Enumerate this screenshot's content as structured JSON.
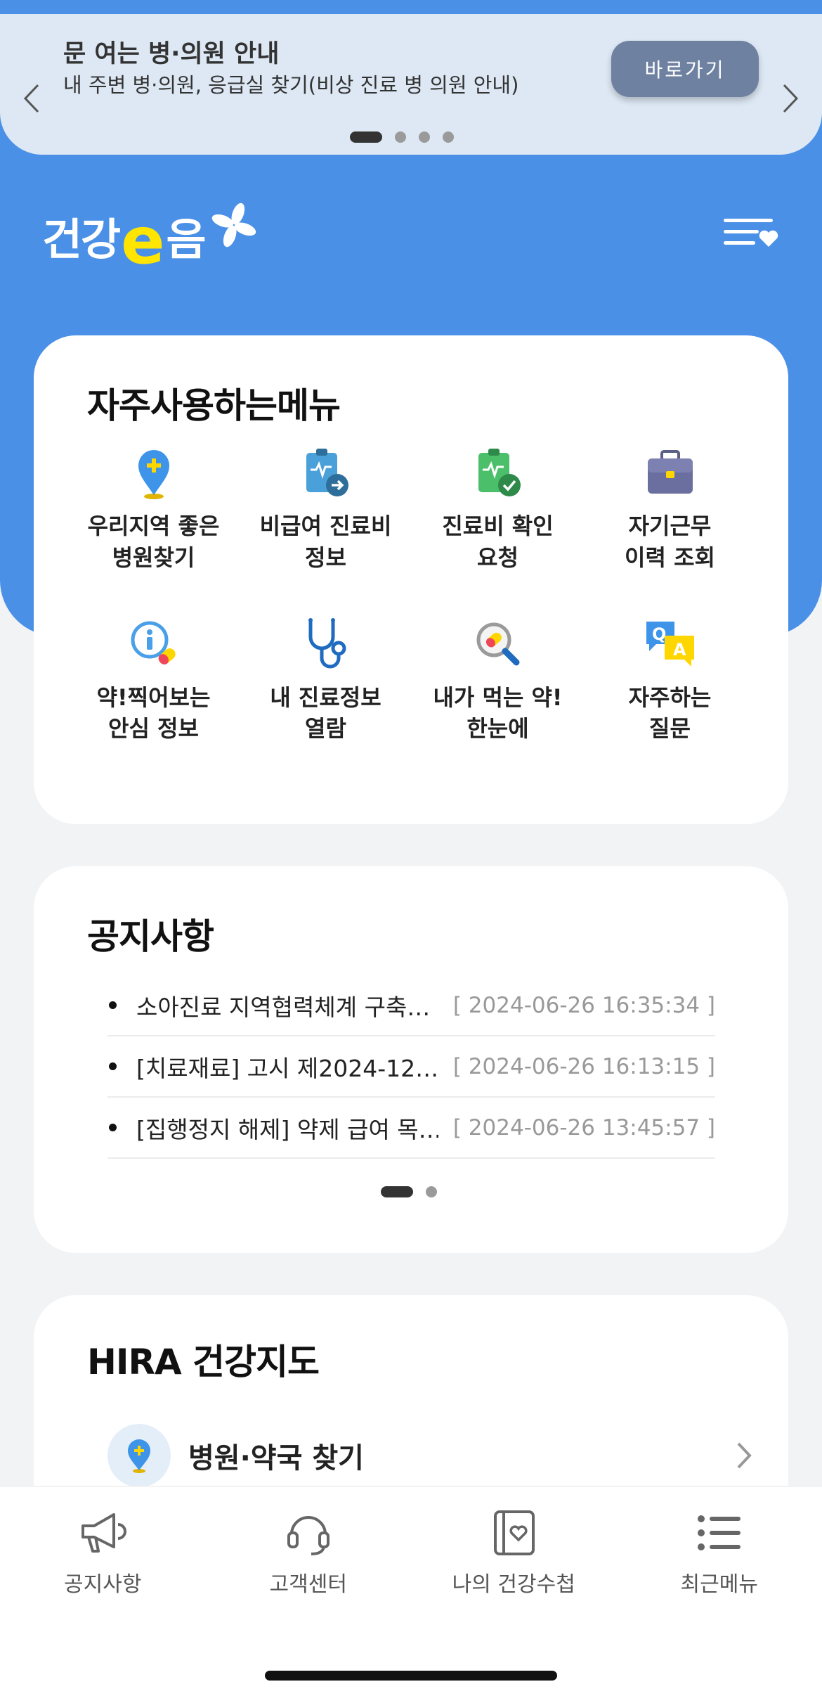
{
  "banner": {
    "title": "문 여는 병·의원 안내",
    "subtitle": "내 주변 병·의원, 응급실 찾기(비상 진료 병 의원 안내)",
    "button_label": "바로가기",
    "pages": 4,
    "active_page": 1
  },
  "header": {
    "logo_prefix": "건강",
    "logo_e": "e",
    "logo_suffix": "음"
  },
  "frequent_menu": {
    "title": "자주사용하는메뉴",
    "items": [
      {
        "label": "우리지역 좋은\n병원찾기",
        "icon": "map-pin-icon"
      },
      {
        "label": "비급여 진료비\n정보",
        "icon": "clipboard-arrow-icon"
      },
      {
        "label": "진료비 확인\n요청",
        "icon": "clipboard-check-icon"
      },
      {
        "label": "자기근무\n이력 조회",
        "icon": "briefcase-icon"
      },
      {
        "label": "약!찍어보는\n안심 정보",
        "icon": "info-pill-icon"
      },
      {
        "label": "내 진료정보\n열람",
        "icon": "stethoscope-icon"
      },
      {
        "label": "내가 먹는 약!\n한눈에",
        "icon": "magnifier-pill-icon"
      },
      {
        "label": "자주하는\n질문",
        "icon": "qa-bubble-icon"
      }
    ]
  },
  "notices": {
    "title": "공지사항",
    "items": [
      {
        "title": "소아진료 지역협력체계 구축…",
        "date": "[ 2024-06-26 16:35:34 ]"
      },
      {
        "title": "[치료재료] 고시 제2024-12…",
        "date": "[ 2024-06-26 16:13:15 ]"
      },
      {
        "title": "[집행정지 해제] 약제 급여 목…",
        "date": "[ 2024-06-26 13:45:57 ]"
      }
    ],
    "pages": 2,
    "active_page": 1
  },
  "hira_map": {
    "title": "HIRA 건강지도",
    "first_item": "병원·약국 찾기"
  },
  "bottom_nav": [
    {
      "label": "공지사항",
      "icon": "megaphone-icon"
    },
    {
      "label": "고객센터",
      "icon": "headset-icon"
    },
    {
      "label": "나의 건강수첩",
      "icon": "health-notebook-icon"
    },
    {
      "label": "최근메뉴",
      "icon": "list-icon"
    }
  ],
  "colors": {
    "primary_blue": "#4a90e6",
    "banner_bg": "#dde8f4",
    "banner_button": "#6f81a1",
    "logo_yellow": "#ffe500"
  }
}
